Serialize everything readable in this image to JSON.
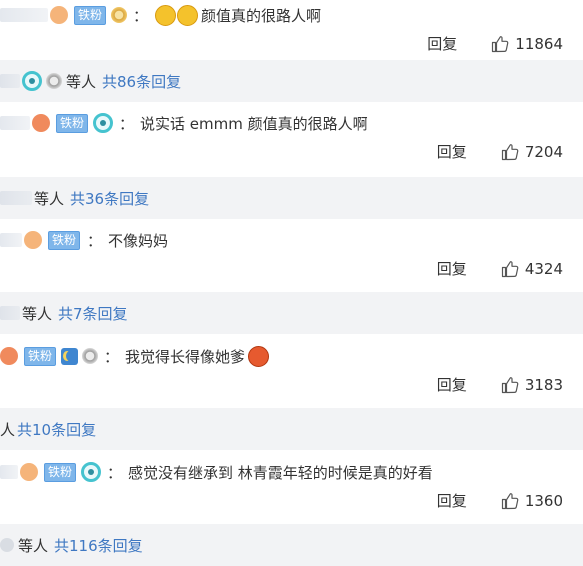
{
  "labels": {
    "colon": "：",
    "reply": "回复",
    "fan_badge": "铁粉",
    "persons_suffix": "等人",
    "persons_suffix_short": "人"
  },
  "comments": [
    {
      "text": "颜值真的很路人啊",
      "likes": "11864"
    },
    {
      "text": "说实话 emmm 颜值真的很路人啊",
      "likes": "7204"
    },
    {
      "text": "不像妈妈",
      "likes": "4324"
    },
    {
      "text": "我觉得长得像她爹",
      "likes": "3183"
    },
    {
      "text": "感觉没有继承到 林青霞年轻的时候是真的好看",
      "likes": "1360"
    }
  ],
  "reply_summaries": [
    "共86条回复",
    "共36条回复",
    "共7条回复",
    "共10条回复",
    "共116条回复"
  ],
  "colors": {
    "link": "#3f78c2",
    "reply_bar_bg": "#f2f3f5",
    "fan_badge_bg": "#7fb6ea"
  }
}
